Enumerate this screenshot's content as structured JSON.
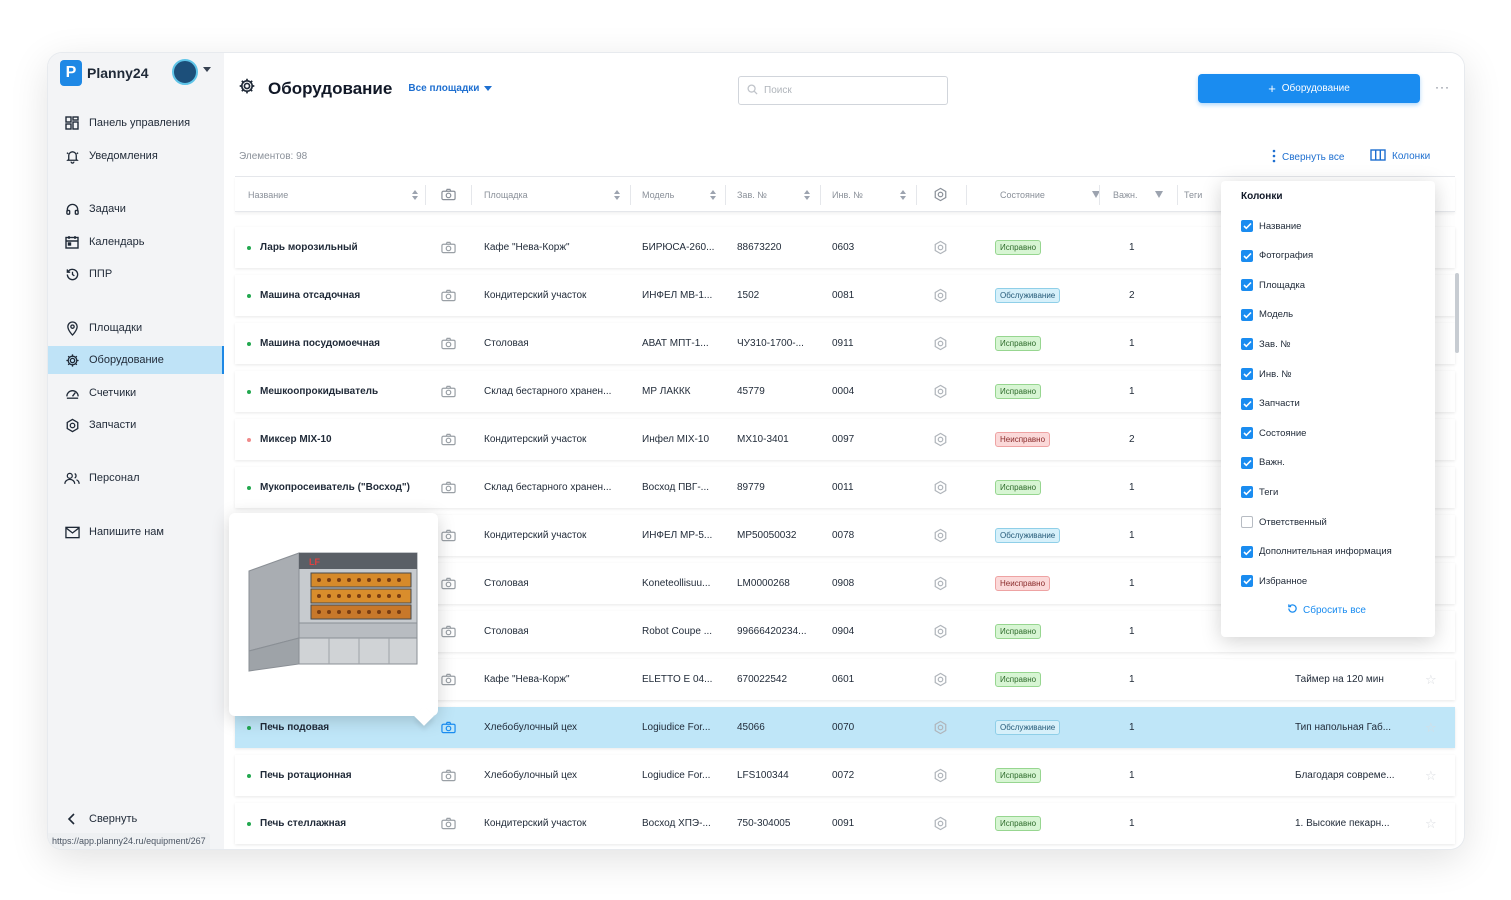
{
  "sidebar": {
    "brand": "Planny24",
    "logo_letter": "P",
    "items": [
      {
        "label": "Панель управления",
        "icon": "dashboard-icon"
      },
      {
        "label": "Уведомления",
        "icon": "bell-icon"
      },
      {
        "label": "Задачи",
        "icon": "headset-icon"
      },
      {
        "label": "Календарь",
        "icon": "calendar-icon"
      },
      {
        "label": "ППР",
        "icon": "history-icon"
      },
      {
        "label": "Площадки",
        "icon": "location-pin-icon"
      },
      {
        "label": "Оборудование",
        "icon": "gear-icon"
      },
      {
        "label": "Счетчики",
        "icon": "gauge-icon"
      },
      {
        "label": "Запчасти",
        "icon": "spare-part-icon"
      },
      {
        "label": "Персонал",
        "icon": "people-icon"
      },
      {
        "label": "Напишите нам",
        "icon": "mail-icon"
      }
    ],
    "collapse_label": "Свернуть",
    "status_url": "https://app.planny24.ru/equipment/267"
  },
  "header": {
    "title": "Оборудование",
    "site_filter": "Все площадки",
    "search_placeholder": "Поиск",
    "add_button": "Оборудование",
    "more": "···"
  },
  "toolbar": {
    "count_text": "Элементов: 98",
    "collapse_all": "Свернуть все",
    "columns": "Колонки"
  },
  "table": {
    "headers": {
      "name": "Название",
      "site": "Площадка",
      "model": "Модель",
      "serial": "Зав. №",
      "inventory": "Инв. №",
      "status": "Состояние",
      "importance": "Важн.",
      "tags": "Теги"
    },
    "rows": [
      {
        "name": "Ларь морозильный",
        "site": "Кафе \"Нева-Корж\"",
        "model": "БИРЮСА-260...",
        "serial": "88673220",
        "inv": "0603",
        "status": "Исправно",
        "status_kind": "ok",
        "imp": "1",
        "info": ""
      },
      {
        "name": "Машина отсадочная",
        "site": "Кондитерский участок",
        "model": "ИНФЕЛ МВ-1...",
        "serial": "1502",
        "inv": "0081",
        "status": "Обслуживание",
        "status_kind": "service",
        "imp": "2",
        "info": ""
      },
      {
        "name": "Машина посудомоечная",
        "site": "Столовая",
        "model": "АВАТ МПТ-1...",
        "serial": "ЧУ310-1700-...",
        "inv": "0911",
        "status": "Исправно",
        "status_kind": "ok",
        "imp": "1",
        "info": ""
      },
      {
        "name": "Мешкоопрокидыватель",
        "site": "Склад бестарного хранен...",
        "model": "МР ЛАККК",
        "serial": "45779",
        "inv": "0004",
        "status": "Исправно",
        "status_kind": "ok",
        "imp": "1",
        "info": ""
      },
      {
        "name": "Миксер MIX-10",
        "site": "Кондитерский участок",
        "model": "Инфел MIX-10",
        "serial": "MX10-3401",
        "inv": "0097",
        "status": "Неисправно",
        "status_kind": "bad",
        "imp": "2",
        "info": ""
      },
      {
        "name": "Мукопросеиватель (\"Восход\")",
        "site": "Склад бестарного хранен...",
        "model": "Восход ПВГ-...",
        "serial": "89779",
        "inv": "0011",
        "status": "Исправно",
        "status_kind": "ok",
        "imp": "1",
        "info": ""
      },
      {
        "name": "",
        "site": "Кондитерский участок",
        "model": "ИНФЕЛ МР-5...",
        "serial": "MP50050032",
        "inv": "0078",
        "status": "Обслуживание",
        "status_kind": "service",
        "imp": "1",
        "info": ""
      },
      {
        "name": "",
        "site": "Столовая",
        "model": "Koneteollisuu...",
        "serial": "LM0000268",
        "inv": "0908",
        "status": "Неисправно",
        "status_kind": "bad",
        "imp": "1",
        "info": ""
      },
      {
        "name": "",
        "site": "Столовая",
        "model": "Robot Coupe ...",
        "serial": "99666420234...",
        "inv": "0904",
        "status": "Исправно",
        "status_kind": "ok",
        "imp": "1",
        "info": ""
      },
      {
        "name": "",
        "site": "Кафе \"Нева-Корж\"",
        "model": "ELETTO E 04...",
        "serial": "670022542",
        "inv": "0601",
        "status": "Исправно",
        "status_kind": "ok",
        "imp": "1",
        "info": "Таймер на 120 мин"
      },
      {
        "name": "Печь подовая",
        "site": "Хлебобулочный цех",
        "model": "Logiudice For...",
        "serial": "45066",
        "inv": "0070",
        "status": "Обслуживание",
        "status_kind": "service",
        "imp": "1",
        "info": "Тип напольная Габ..."
      },
      {
        "name": "Печь ротационная",
        "site": "Хлебобулочный цех",
        "model": "Logiudice For...",
        "serial": "LFS100344",
        "inv": "0072",
        "status": "Исправно",
        "status_kind": "ok",
        "imp": "1",
        "info": "Благодаря совреме..."
      },
      {
        "name": "Печь стеллажная",
        "site": "Кондитерский участок",
        "model": "Восход ХПЭ-...",
        "serial": "750-304005",
        "inv": "0091",
        "status": "Исправно",
        "status_kind": "ok",
        "imp": "1",
        "info": "1. Высокие пекарн..."
      }
    ]
  },
  "columns_panel": {
    "title": "Колонки",
    "options": [
      {
        "label": "Название",
        "checked": true
      },
      {
        "label": "Фотография",
        "checked": true
      },
      {
        "label": "Площадка",
        "checked": true
      },
      {
        "label": "Модель",
        "checked": true
      },
      {
        "label": "Зав. №",
        "checked": true
      },
      {
        "label": "Инв. №",
        "checked": true
      },
      {
        "label": "Запчасти",
        "checked": true
      },
      {
        "label": "Состояние",
        "checked": true
      },
      {
        "label": "Важн.",
        "checked": true
      },
      {
        "label": "Теги",
        "checked": true
      },
      {
        "label": "Ответственный",
        "checked": false
      },
      {
        "label": "Дополнительная информация",
        "checked": true
      },
      {
        "label": "Избранное",
        "checked": true
      }
    ],
    "reset": "Сбросить все"
  },
  "colors": {
    "accent": "#1a8cf0",
    "selected_row": "#bfe6f8",
    "active_nav": "#bfe3f7"
  }
}
